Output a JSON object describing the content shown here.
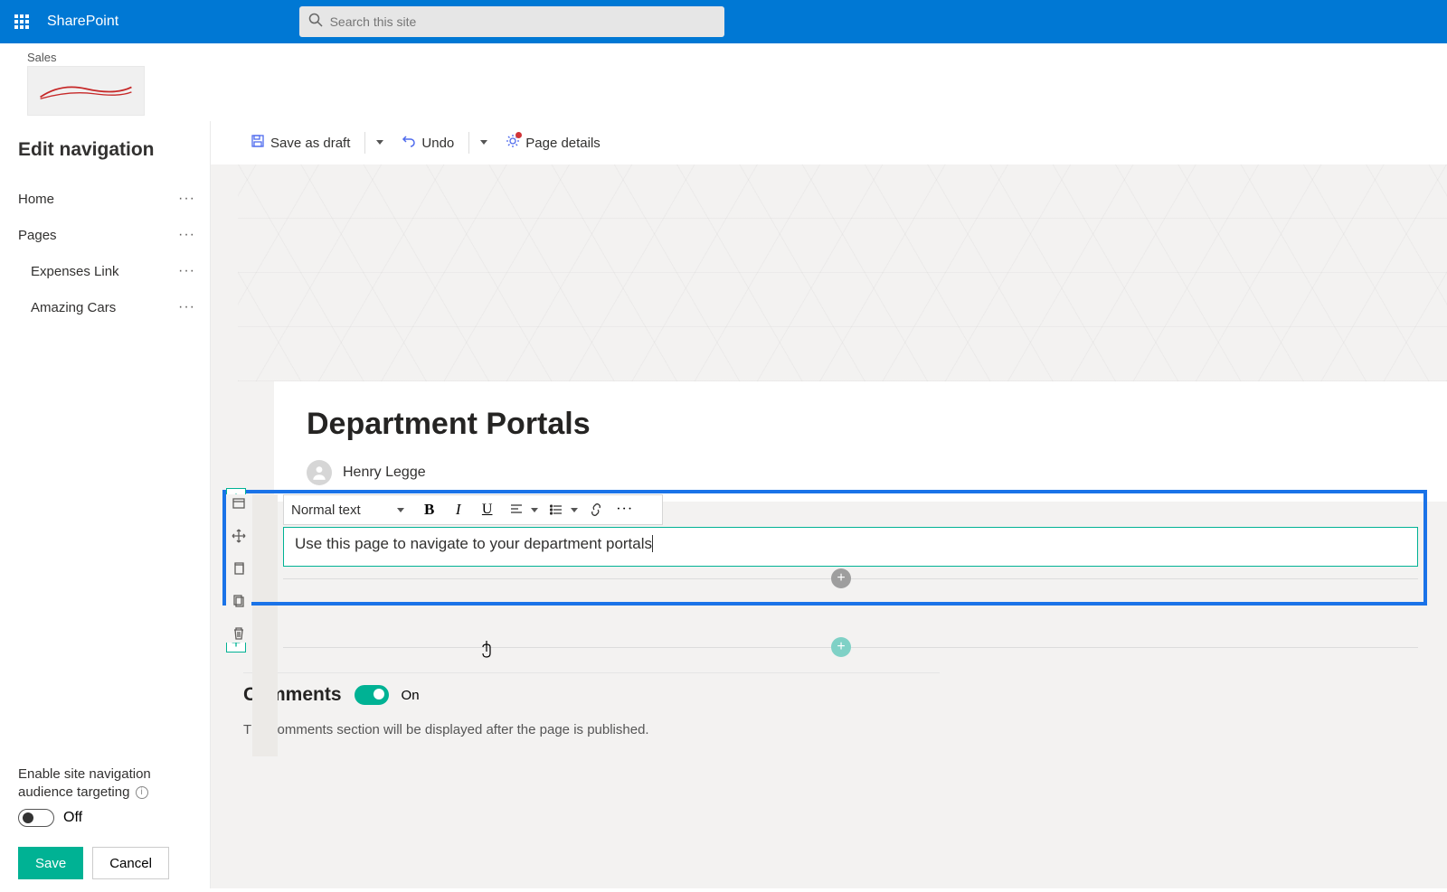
{
  "suite": {
    "app": "SharePoint"
  },
  "search": {
    "placeholder": "Search this site"
  },
  "site": {
    "name": "Sales"
  },
  "leftNav": {
    "title": "Edit navigation",
    "items": [
      "Home",
      "Pages",
      "Expenses Link",
      "Amazing Cars"
    ],
    "audienceLabel": "Enable site navigation audience targeting",
    "toggleState": "Off",
    "save": "Save",
    "cancel": "Cancel"
  },
  "cmd": {
    "saveDraft": "Save as draft",
    "undo": "Undo",
    "pageDetails": "Page details"
  },
  "page": {
    "title": "Department Portals",
    "author": "Henry Legge"
  },
  "richText": {
    "styleLabel": "Normal text",
    "content": "Use this page to navigate to your department portals"
  },
  "comments": {
    "title": "Comments",
    "state": "On",
    "note": "The comments section will be displayed after the page is published."
  }
}
